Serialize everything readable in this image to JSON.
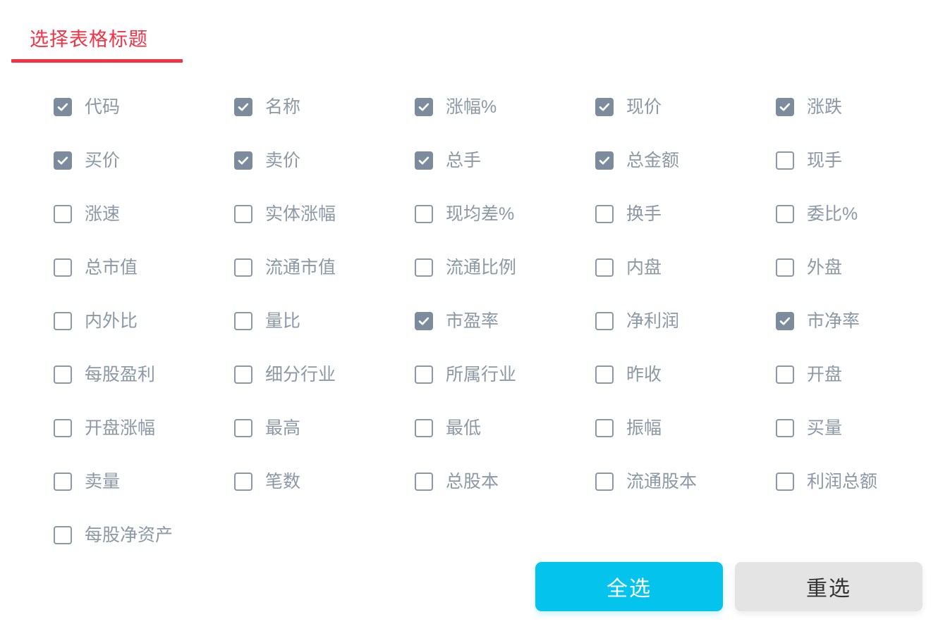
{
  "header": {
    "title": "选择表格标题",
    "accent_color": "#f23345"
  },
  "theme": {
    "checkbox_checked_color": "#7d8c9c",
    "checkbox_border_color": "#8b98a6",
    "label_color": "#8c98a5",
    "primary_button_color": "#04c4ed",
    "secondary_button_color": "#e4e4e4",
    "background_color": "#ffffff"
  },
  "options": [
    {
      "label": "代码",
      "checked": true
    },
    {
      "label": "名称",
      "checked": true
    },
    {
      "label": "涨幅%",
      "checked": true
    },
    {
      "label": "现价",
      "checked": true
    },
    {
      "label": "涨跌",
      "checked": true
    },
    {
      "label": "买价",
      "checked": true
    },
    {
      "label": "卖价",
      "checked": true
    },
    {
      "label": "总手",
      "checked": true
    },
    {
      "label": "总金额",
      "checked": true
    },
    {
      "label": "现手",
      "checked": false
    },
    {
      "label": "涨速",
      "checked": false
    },
    {
      "label": "实体涨幅",
      "checked": false
    },
    {
      "label": "现均差%",
      "checked": false
    },
    {
      "label": "换手",
      "checked": false
    },
    {
      "label": "委比%",
      "checked": false
    },
    {
      "label": "总市值",
      "checked": false
    },
    {
      "label": "流通市值",
      "checked": false
    },
    {
      "label": "流通比例",
      "checked": false
    },
    {
      "label": "内盘",
      "checked": false
    },
    {
      "label": "外盘",
      "checked": false
    },
    {
      "label": "内外比",
      "checked": false
    },
    {
      "label": "量比",
      "checked": false
    },
    {
      "label": "市盈率",
      "checked": true
    },
    {
      "label": "净利润",
      "checked": false
    },
    {
      "label": "市净率",
      "checked": true
    },
    {
      "label": "每股盈利",
      "checked": false
    },
    {
      "label": "细分行业",
      "checked": false
    },
    {
      "label": "所属行业",
      "checked": false
    },
    {
      "label": "昨收",
      "checked": false
    },
    {
      "label": "开盘",
      "checked": false
    },
    {
      "label": "开盘涨幅",
      "checked": false
    },
    {
      "label": "最高",
      "checked": false
    },
    {
      "label": "最低",
      "checked": false
    },
    {
      "label": "振幅",
      "checked": false
    },
    {
      "label": "买量",
      "checked": false
    },
    {
      "label": "卖量",
      "checked": false
    },
    {
      "label": "笔数",
      "checked": false
    },
    {
      "label": "总股本",
      "checked": false
    },
    {
      "label": "流通股本",
      "checked": false
    },
    {
      "label": "利润总额",
      "checked": false
    },
    {
      "label": "每股净资产",
      "checked": false
    }
  ],
  "footer": {
    "select_all_label": "全选",
    "reset_label": "重选"
  }
}
